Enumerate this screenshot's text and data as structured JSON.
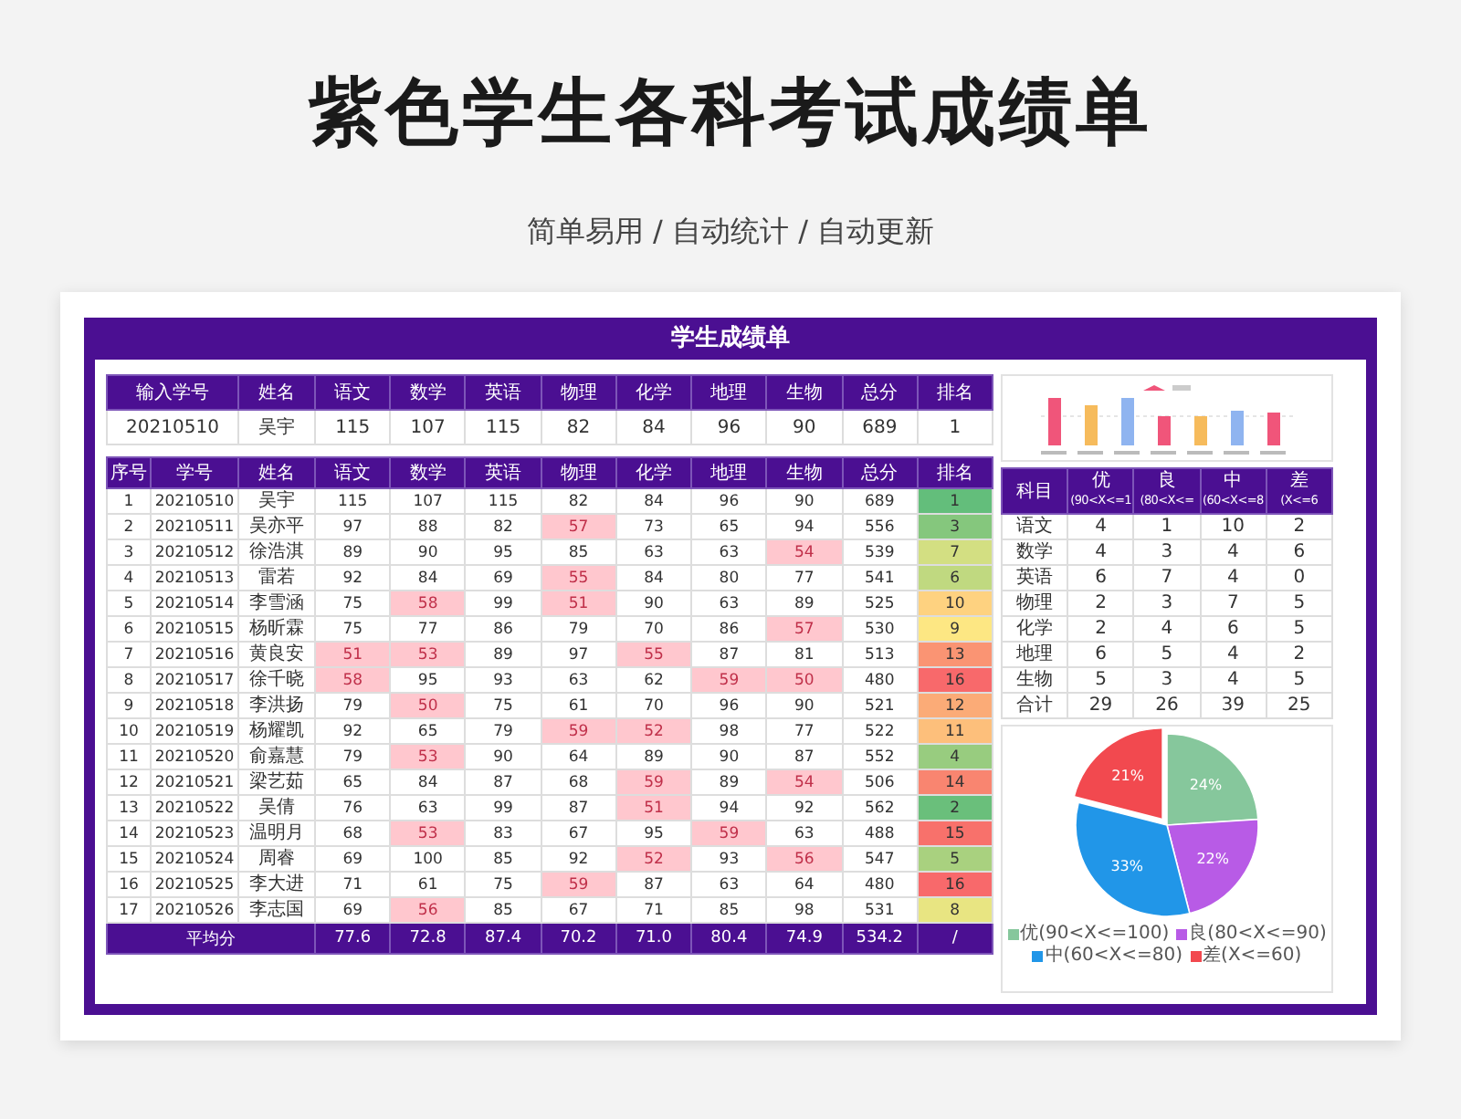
{
  "header": {
    "title": "紫色学生各科考试成绩单",
    "subtitle": "简单易用 / 自动统计 / 自动更新"
  },
  "sheet": {
    "title": "学生成绩单",
    "lookup": {
      "columns": [
        "输入学号",
        "姓名",
        "语文",
        "数学",
        "英语",
        "物理",
        "化学",
        "地理",
        "生物",
        "总分",
        "排名"
      ],
      "values": [
        "20210510",
        "吴宇",
        "115",
        "107",
        "115",
        "82",
        "84",
        "96",
        "90",
        "689",
        "1"
      ]
    },
    "table": {
      "columns": [
        "序号",
        "学号",
        "姓名",
        "语文",
        "数学",
        "英语",
        "物理",
        "化学",
        "地理",
        "生物",
        "总分",
        "排名"
      ],
      "rows": [
        {
          "no": "1",
          "id": "20210510",
          "name": "吴宇",
          "scores": [
            "115",
            "107",
            "115",
            "82",
            "84",
            "96",
            "90"
          ],
          "low": [
            false,
            false,
            false,
            false,
            false,
            false,
            false
          ],
          "total": "689",
          "rank": "1",
          "color": "#63be7b"
        },
        {
          "no": "2",
          "id": "20210511",
          "name": "吴亦平",
          "scores": [
            "97",
            "88",
            "82",
            "57",
            "73",
            "65",
            "94"
          ],
          "low": [
            false,
            false,
            false,
            true,
            false,
            false,
            false
          ],
          "total": "556",
          "rank": "3",
          "color": "#85c77d"
        },
        {
          "no": "3",
          "id": "20210512",
          "name": "徐浩淇",
          "scores": [
            "89",
            "90",
            "95",
            "85",
            "63",
            "63",
            "54"
          ],
          "low": [
            false,
            false,
            false,
            false,
            false,
            false,
            true
          ],
          "total": "539",
          "rank": "7",
          "color": "#d3df82"
        },
        {
          "no": "4",
          "id": "20210513",
          "name": "雷若",
          "scores": [
            "92",
            "84",
            "69",
            "55",
            "84",
            "80",
            "77"
          ],
          "low": [
            false,
            false,
            false,
            true,
            false,
            false,
            false
          ],
          "total": "541",
          "rank": "6",
          "color": "#c0d980"
        },
        {
          "no": "5",
          "id": "20210514",
          "name": "李雪涵",
          "scores": [
            "75",
            "58",
            "99",
            "51",
            "90",
            "63",
            "89"
          ],
          "low": [
            false,
            true,
            false,
            true,
            false,
            false,
            false
          ],
          "total": "525",
          "rank": "10",
          "color": "#fed280"
        },
        {
          "no": "6",
          "id": "20210515",
          "name": "杨昕霖",
          "scores": [
            "75",
            "77",
            "86",
            "79",
            "70",
            "86",
            "57"
          ],
          "low": [
            false,
            false,
            false,
            false,
            false,
            false,
            true
          ],
          "total": "530",
          "rank": "9",
          "color": "#fde783"
        },
        {
          "no": "7",
          "id": "20210516",
          "name": "黄良安",
          "scores": [
            "51",
            "53",
            "89",
            "97",
            "55",
            "87",
            "81"
          ],
          "low": [
            true,
            true,
            false,
            false,
            true,
            false,
            false
          ],
          "total": "513",
          "rank": "13",
          "color": "#fa9473"
        },
        {
          "no": "8",
          "id": "20210517",
          "name": "徐千晓",
          "scores": [
            "58",
            "95",
            "93",
            "63",
            "62",
            "59",
            "50"
          ],
          "low": [
            true,
            false,
            false,
            false,
            false,
            true,
            true
          ],
          "total": "480",
          "rank": "16",
          "color": "#f8696b"
        },
        {
          "no": "9",
          "id": "20210518",
          "name": "李洪扬",
          "scores": [
            "79",
            "50",
            "75",
            "61",
            "70",
            "96",
            "90"
          ],
          "low": [
            false,
            true,
            false,
            false,
            false,
            false,
            false
          ],
          "total": "521",
          "rank": "12",
          "color": "#fbab77"
        },
        {
          "no": "10",
          "id": "20210519",
          "name": "杨耀凯",
          "scores": [
            "92",
            "65",
            "79",
            "59",
            "52",
            "98",
            "77"
          ],
          "low": [
            false,
            false,
            false,
            true,
            true,
            false,
            false
          ],
          "total": "522",
          "rank": "11",
          "color": "#fdbf7b"
        },
        {
          "no": "11",
          "id": "20210520",
          "name": "俞嘉慧",
          "scores": [
            "79",
            "53",
            "90",
            "64",
            "89",
            "90",
            "87"
          ],
          "low": [
            false,
            true,
            false,
            false,
            false,
            false,
            false
          ],
          "total": "552",
          "rank": "4",
          "color": "#98cc7f"
        },
        {
          "no": "12",
          "id": "20210521",
          "name": "梁艺茹",
          "scores": [
            "65",
            "84",
            "87",
            "68",
            "59",
            "89",
            "54"
          ],
          "low": [
            false,
            false,
            false,
            false,
            true,
            false,
            true
          ],
          "total": "506",
          "rank": "14",
          "color": "#f98570"
        },
        {
          "no": "13",
          "id": "20210522",
          "name": "吴倩",
          "scores": [
            "76",
            "63",
            "99",
            "87",
            "51",
            "94",
            "92"
          ],
          "low": [
            false,
            false,
            false,
            false,
            true,
            false,
            false
          ],
          "total": "562",
          "rank": "2",
          "color": "#6abf7b"
        },
        {
          "no": "14",
          "id": "20210523",
          "name": "温明月",
          "scores": [
            "68",
            "53",
            "83",
            "67",
            "95",
            "59",
            "63"
          ],
          "low": [
            false,
            true,
            false,
            false,
            false,
            true,
            false
          ],
          "total": "488",
          "rank": "15",
          "color": "#f8716b"
        },
        {
          "no": "15",
          "id": "20210524",
          "name": "周睿",
          "scores": [
            "69",
            "100",
            "85",
            "92",
            "52",
            "93",
            "56"
          ],
          "low": [
            false,
            false,
            false,
            false,
            true,
            false,
            true
          ],
          "total": "547",
          "rank": "5",
          "color": "#a9d17f"
        },
        {
          "no": "16",
          "id": "20210525",
          "name": "李大进",
          "scores": [
            "71",
            "61",
            "75",
            "59",
            "87",
            "63",
            "64"
          ],
          "low": [
            false,
            false,
            false,
            true,
            false,
            false,
            false
          ],
          "total": "480",
          "rank": "16",
          "color": "#f8696b"
        },
        {
          "no": "17",
          "id": "20210526",
          "name": "李志国",
          "scores": [
            "69",
            "56",
            "85",
            "67",
            "71",
            "85",
            "98"
          ],
          "low": [
            false,
            true,
            false,
            false,
            false,
            false,
            false
          ],
          "total": "531",
          "rank": "8",
          "color": "#e8e582"
        }
      ],
      "footer": {
        "label": "平均分",
        "values": [
          "77.6",
          "72.8",
          "87.4",
          "70.2",
          "71.0",
          "80.4",
          "74.9",
          "534.2"
        ],
        "rank": "/"
      }
    },
    "stats": {
      "columns": [
        {
          "label": "科目"
        },
        {
          "label": "优",
          "range": "(90<X<=1"
        },
        {
          "label": "良",
          "range": "(80<X<="
        },
        {
          "label": "中",
          "range": "(60<X<=8"
        },
        {
          "label": "差",
          "range": "(X<=6"
        }
      ],
      "rows": [
        [
          "语文",
          "4",
          "1",
          "10",
          "2"
        ],
        [
          "数学",
          "4",
          "3",
          "4",
          "6"
        ],
        [
          "英语",
          "6",
          "7",
          "4",
          "0"
        ],
        [
          "物理",
          "2",
          "3",
          "7",
          "5"
        ],
        [
          "化学",
          "2",
          "4",
          "6",
          "5"
        ],
        [
          "地理",
          "6",
          "5",
          "4",
          "2"
        ],
        [
          "生物",
          "5",
          "3",
          "4",
          "5"
        ],
        [
          "合计",
          "29",
          "26",
          "39",
          "25"
        ]
      ]
    },
    "pie": {
      "chart_data": {
        "type": "pie",
        "legend": true,
        "categories": [
          "优(90<X<=100)",
          "良(80<X<=90)",
          "中(60<X<=80)",
          "差(X<=60)"
        ],
        "values": [
          24,
          22,
          33,
          21
        ],
        "value_labels": [
          "24%",
          "22%",
          "33%",
          "21%"
        ],
        "colors": [
          "#86c79c",
          "#b85be6",
          "#2196e8",
          "#f2494f"
        ]
      }
    }
  }
}
